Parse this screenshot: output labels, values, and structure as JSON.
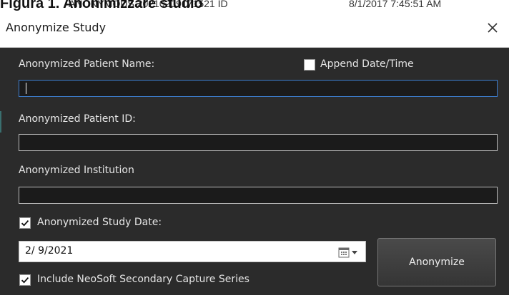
{
  "caption": {
    "title": "Figura 1. Anonimizzare studio",
    "behind_name": "ANONYMOUS 20210209171521 ID",
    "behind_date": "8/1/2017 7:45:51 AM"
  },
  "dialog": {
    "title": "Anonymize Study",
    "close_glyph": "✕",
    "patient_name": {
      "label": "Anonymized Patient Name:",
      "value": ""
    },
    "append_datetime": {
      "label": "Append Date/Time",
      "checked": false
    },
    "patient_id": {
      "label": "Anonymized Patient ID:",
      "value": ""
    },
    "institution": {
      "label": "Anonymized Institution",
      "value": ""
    },
    "study_date_check": {
      "label": "Anonymized Study Date:",
      "checked": true
    },
    "study_date": {
      "value": "2/ 9/2021"
    },
    "secondary_capture": {
      "label": "Include NeoSoft Secondary Capture Series",
      "checked": true
    },
    "anonymize_button": "Anonymize"
  },
  "icons": {
    "close": "close-icon",
    "check": "checkmark-icon",
    "calendar": "calendar-icon",
    "dropdown": "chevron-down-icon"
  },
  "colors": {
    "dialog_bg": "#2b2b2b",
    "focus_border": "#3d7fd1",
    "field_bg": "#1b1b1b"
  }
}
